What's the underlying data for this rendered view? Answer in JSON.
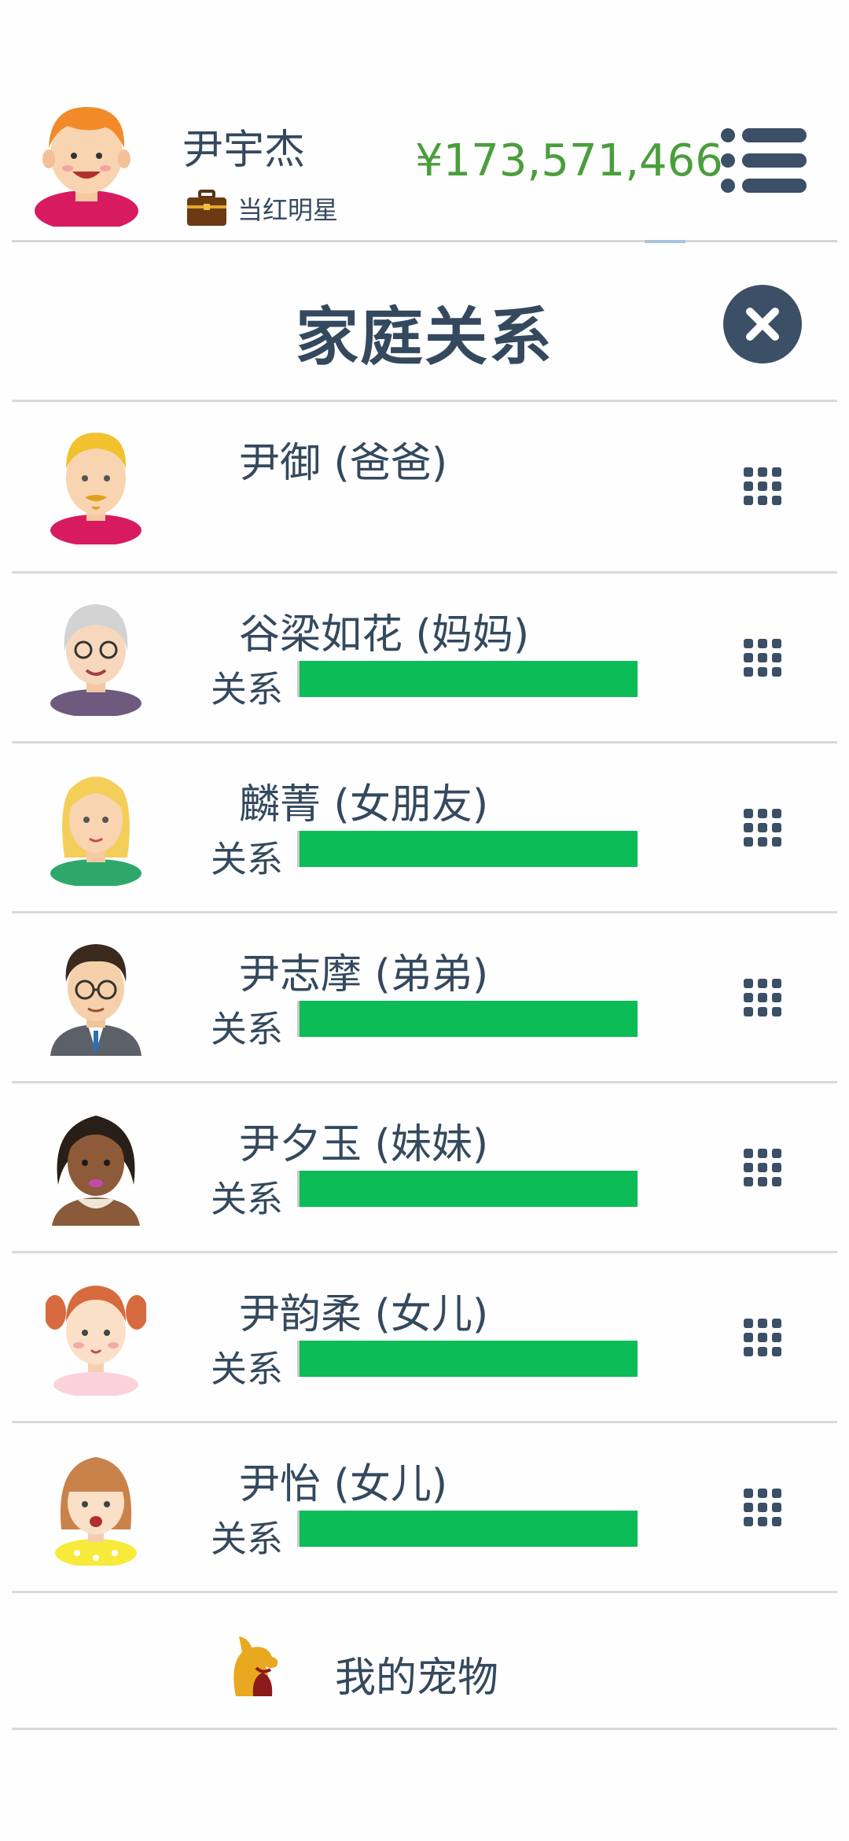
{
  "player": {
    "name": "尹宇杰",
    "job": "当红明星",
    "money": "¥173,571,466"
  },
  "dialog": {
    "title": "家庭关系"
  },
  "relation_label": "关系",
  "members": [
    {
      "name": "尹御 (爸爸)",
      "relationship": null
    },
    {
      "name": "谷梁如花 (妈妈)",
      "relationship": 1.0
    },
    {
      "name": "麟菁 (女朋友)",
      "relationship": 1.0
    },
    {
      "name": "尹志摩 (弟弟)",
      "relationship": 1.0
    },
    {
      "name": "尹夕玉 (妹妹)",
      "relationship": 1.0
    },
    {
      "name": "尹韵柔 (女儿)",
      "relationship": 1.0
    },
    {
      "name": "尹怡 (女儿)",
      "relationship": 1.0
    }
  ],
  "pets": {
    "label": "我的宠物"
  },
  "colors": {
    "text": "#34495e",
    "money": "#4a9e3c",
    "relationship_bar": "#0cbc57",
    "icon_dark": "#3b4f66"
  },
  "icons": {
    "menu": "menu-icon",
    "close": "close-icon",
    "more": "grid-icon",
    "job": "briefcase-icon",
    "pet": "dog-icon"
  }
}
